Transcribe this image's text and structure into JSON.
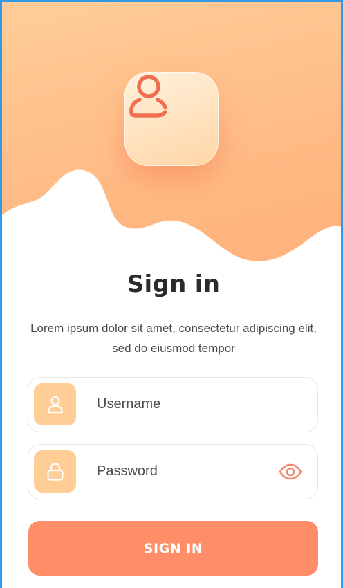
{
  "hero": {
    "avatar_icon": "user-icon",
    "gradient_top": "#ffcd98",
    "gradient_bottom": "#ffb47e",
    "icon_stroke": "#ef6f4f"
  },
  "header": {
    "title": "Sign in",
    "subtitle": "Lorem ipsum dolor sit amet, consectetur adipiscing elit, sed do eiusmod tempor"
  },
  "form": {
    "username": {
      "label": "Username",
      "icon": "user-icon"
    },
    "password": {
      "label": "Password",
      "icon": "lock-icon",
      "toggle_icon": "eye-icon"
    }
  },
  "actions": {
    "sign_in_label": "SIGN IN",
    "accent": "#ff8e68"
  }
}
